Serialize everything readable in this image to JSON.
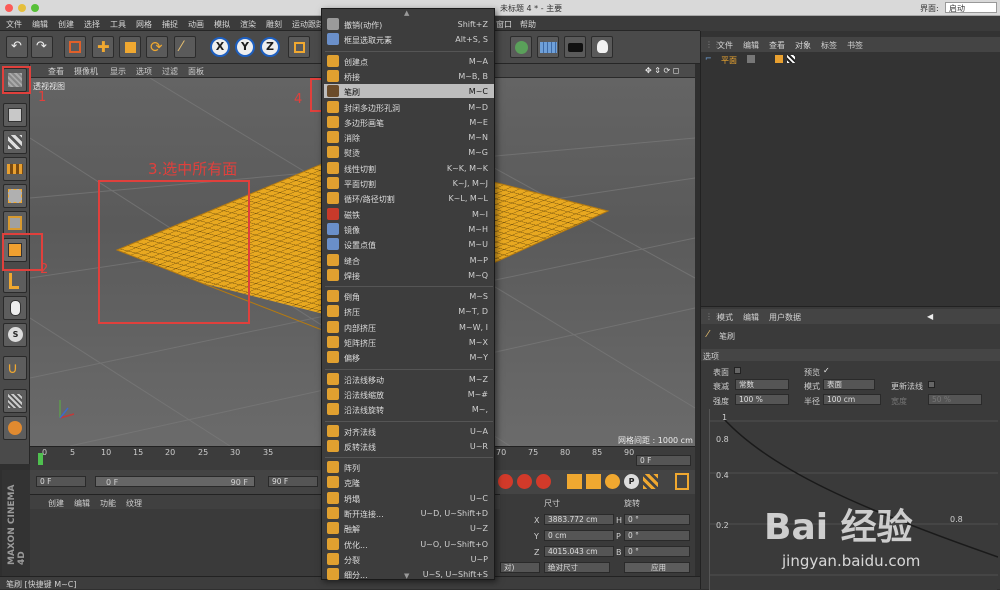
{
  "window": {
    "title": "未标题 4 * - 主要",
    "layout_label": "界面:",
    "layout_value": "启动"
  },
  "menubar": [
    "文件",
    "编辑",
    "创建",
    "选择",
    "工具",
    "网格",
    "捕捉",
    "动画",
    "模拟",
    "渲染",
    "雕刻",
    "运动跟踪",
    "窗口",
    "帮助"
  ],
  "viewport": {
    "menu": [
      "查看",
      "摄像机",
      "显示",
      "选项",
      "过滤",
      "面板"
    ],
    "label": "透视视图",
    "grid_spacing": "网格间距 : 1000 cm"
  },
  "annotations": {
    "a1": "1",
    "a2": "2",
    "a3": "3.选中所有面",
    "a4": "4"
  },
  "dropdown": {
    "items": [
      {
        "label": "撤销(动作)",
        "shortcut": "Shift+Z",
        "color": "#9a9a9a"
      },
      {
        "label": "框显选取元素",
        "shortcut": "Alt+S, S",
        "color": "#6a8fc9"
      },
      {
        "sep": true
      },
      {
        "label": "创建点",
        "shortcut": "M~A",
        "color": "#e0a030"
      },
      {
        "label": "桥接",
        "shortcut": "M~B, B",
        "color": "#e0a030"
      },
      {
        "label": "笔刷",
        "shortcut": "M~C",
        "color": "#6b4c2a",
        "highlight": true
      },
      {
        "label": "封闭多边形孔洞",
        "shortcut": "M~D",
        "color": "#e0a030"
      },
      {
        "label": "多边形画笔",
        "shortcut": "M~E",
        "color": "#e0a030"
      },
      {
        "label": "消除",
        "shortcut": "M~N",
        "color": "#e0a030"
      },
      {
        "label": "熨烫",
        "shortcut": "M~G",
        "color": "#e0a030"
      },
      {
        "label": "线性切割",
        "shortcut": "K~K, M~K",
        "color": "#e0a030"
      },
      {
        "label": "平面切割",
        "shortcut": "K~J, M~J",
        "color": "#e0a030"
      },
      {
        "label": "循环/路径切割",
        "shortcut": "K~L, M~L",
        "color": "#e0a030"
      },
      {
        "label": "磁铁",
        "shortcut": "M~I",
        "color": "#c83a2a"
      },
      {
        "label": "镜像",
        "shortcut": "M~H",
        "color": "#6a8fc9"
      },
      {
        "label": "设置点值",
        "shortcut": "M~U",
        "color": "#6a8fc9"
      },
      {
        "label": "缝合",
        "shortcut": "M~P",
        "color": "#e0a030"
      },
      {
        "label": "焊接",
        "shortcut": "M~Q",
        "color": "#e0a030"
      },
      {
        "sep": true
      },
      {
        "label": "倒角",
        "shortcut": "M~S",
        "color": "#e0a030"
      },
      {
        "label": "挤压",
        "shortcut": "M~T, D",
        "color": "#e0a030"
      },
      {
        "label": "内部挤压",
        "shortcut": "M~W, I",
        "color": "#e0a030"
      },
      {
        "label": "矩阵挤压",
        "shortcut": "M~X",
        "color": "#e0a030"
      },
      {
        "label": "偏移",
        "shortcut": "M~Y",
        "color": "#e0a030"
      },
      {
        "sep": true
      },
      {
        "label": "沿法线移动",
        "shortcut": "M~Z",
        "color": "#e0a030"
      },
      {
        "label": "沿法线缩放",
        "shortcut": "M~#",
        "color": "#e0a030"
      },
      {
        "label": "沿法线旋转",
        "shortcut": "M~,",
        "color": "#e0a030"
      },
      {
        "sep": true
      },
      {
        "label": "对齐法线",
        "shortcut": "U~A",
        "color": "#e0a030"
      },
      {
        "label": "反转法线",
        "shortcut": "U~R",
        "color": "#e0a030"
      },
      {
        "sep": true
      },
      {
        "label": "阵列",
        "shortcut": "",
        "color": "#e0a030"
      },
      {
        "label": "克隆",
        "shortcut": "",
        "color": "#e0a030"
      },
      {
        "label": "坍塌",
        "shortcut": "U~C",
        "color": "#e0a030"
      },
      {
        "label": "断开连接...",
        "shortcut": "U~D, U~Shift+D",
        "color": "#e0a030"
      },
      {
        "label": "融解",
        "shortcut": "U~Z",
        "color": "#e0a030"
      },
      {
        "label": "优化...",
        "shortcut": "U~O, U~Shift+O",
        "color": "#e0a030"
      },
      {
        "label": "分裂",
        "shortcut": "U~P",
        "color": "#e0a030"
      },
      {
        "label": "细分...",
        "shortcut": "U~S, U~Shift+S",
        "color": "#e0a030"
      }
    ]
  },
  "timeline": {
    "ticks": [
      "0",
      "5",
      "10",
      "15",
      "20",
      "25",
      "30",
      "35",
      "70",
      "75",
      "80",
      "85",
      "90"
    ],
    "current_frame": "0 F",
    "start": "0 F",
    "range_start": "0 F",
    "range_end": "90 F",
    "end": "90 F"
  },
  "material_panel": {
    "menu": [
      "创建",
      "编辑",
      "功能",
      "纹理"
    ]
  },
  "coords": {
    "size_header": "尺寸",
    "rotation_header": "旋转",
    "rows": [
      {
        "axis": "X",
        "size": "3883.772 cm",
        "rot_axis": "H",
        "rot": "0 °"
      },
      {
        "axis": "Y",
        "size": "0 cm",
        "rot_axis": "P",
        "rot": "0 °"
      },
      {
        "axis": "Z",
        "size": "4015.043 cm",
        "rot_axis": "B",
        "rot": "0 °"
      }
    ],
    "mode_select": "对)",
    "abs_select": "绝对尺寸",
    "apply": "应用"
  },
  "object_manager": {
    "menu": [
      "文件",
      "编辑",
      "查看",
      "对象",
      "标签",
      "书签"
    ],
    "object_name": "平面"
  },
  "attribute_manager": {
    "menu": [
      "模式",
      "编辑",
      "用户数据"
    ],
    "tool_name": "笔刷",
    "section": "选项",
    "surface_label": "表面",
    "preview_label": "预览",
    "falloff_label": "衰减",
    "falloff_value": "常数",
    "mode_label": "模式",
    "mode_value": "表面",
    "update_normals_label": "更新法线",
    "strength_label": "强度",
    "strength_value": "100 %",
    "radius_label": "半径",
    "radius_value": "100 cm",
    "width_label": "宽度",
    "width_value": "50 %",
    "curve_labels": [
      "1",
      "0.8",
      "0.4",
      "0.2",
      "0.8"
    ]
  },
  "statusbar": {
    "text": "笔刷 [快捷键 M~C]"
  },
  "brand": {
    "line1": "MAXON",
    "line2": "CINEMA 4D"
  },
  "watermark": {
    "logo": "Bai 经验",
    "url": "jingyan.baidu.com"
  }
}
